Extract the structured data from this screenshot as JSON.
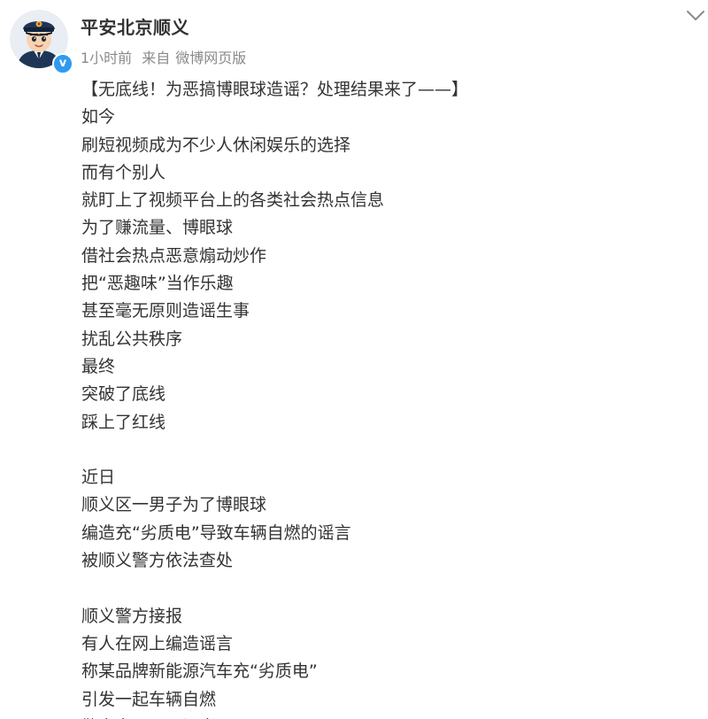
{
  "post": {
    "author": "平安北京顺义",
    "time": "1小时前",
    "source_prefix": "来自",
    "source": "微博网页版",
    "verified_mark": "v",
    "lines": [
      "【无底线！为恶搞博眼球造谣？处理结果来了——】",
      "如今",
      "刷短视频成为不少人休闲娱乐的选择",
      "而有个别人",
      "就盯上了视频平台上的各类社会热点信息",
      "为了赚流量、博眼球",
      "借社会热点恶意煽动炒作",
      "把“恶趣味”当作乐趣",
      "甚至毫无原则造谣生事",
      "扰乱公共秩序",
      "最终",
      "突破了底线",
      "踩上了红线",
      "",
      "近日",
      "顺义区一男子为了博眼球",
      "编造充“劣质电”导致车辆自燃的谣言",
      "被顺义警方依法查处",
      "",
      "顺义警方接报",
      "有人在网上编造谣言",
      "称某品牌新能源汽车充“劣质电”",
      "引发一起车辆自燃",
      "警方立即开展调查"
    ]
  },
  "icons": {
    "avatar": "police-officer-avatar",
    "menu": "chevron-down-icon"
  },
  "colors": {
    "verified": "#2f9af0",
    "text": "#333333",
    "meta": "#8a8a8a"
  }
}
